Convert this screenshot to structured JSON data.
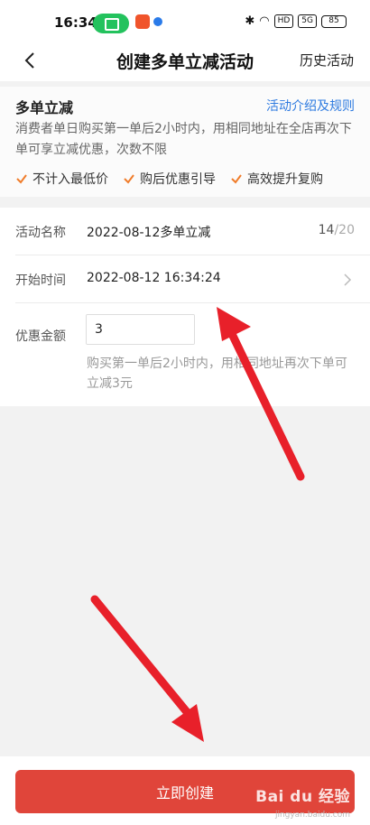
{
  "status_bar": {
    "time": "16:34",
    "network_chip": "HD",
    "signal": "5G",
    "battery": "85"
  },
  "nav": {
    "title": "创建多单立减活动",
    "history_label": "历史活动"
  },
  "intro": {
    "title": "多单立减",
    "link_label": "活动介绍及规则",
    "description": "消费者单日购买第一单后2小时内，用相同地址在全店再次下单可享立减优惠，次数不限",
    "features": [
      "不计入最低价",
      "购后优惠引导",
      "高效提升复购"
    ]
  },
  "form": {
    "name_label": "活动名称",
    "name_value": "2022-08-12多单立减",
    "name_count": "14",
    "name_count_total": "/20",
    "start_label": "开始时间",
    "start_value": "2022-08-12 16:34:24",
    "amount_label": "优惠金额",
    "amount_value": "3",
    "amount_unit": "元",
    "amount_hint": "购买第一单后2小时内，用相同地址再次下单可立减3元"
  },
  "actions": {
    "create_label": "立即创建"
  },
  "watermark": {
    "brand": "Bai du 经验",
    "url": "jingyan.baidu.com"
  },
  "colors": {
    "accent": "#e0453a",
    "link": "#2f7be0",
    "check": "#f07c2a",
    "arrow": "#e8202a"
  }
}
